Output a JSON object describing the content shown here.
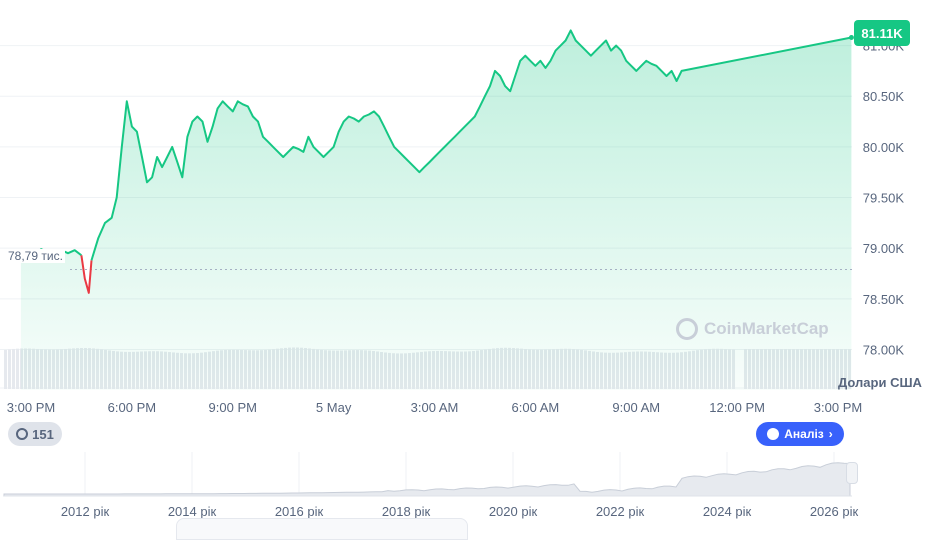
{
  "chart_data": {
    "type": "area",
    "title": "",
    "xlabel": "",
    "ylabel": "",
    "currency_label": "Долари США",
    "current_price_label": "81.11K",
    "reference_label": "78,79 тис.",
    "reference_value": 78790,
    "ylim": [
      77600,
      81450
    ],
    "y_ticks": [
      78000,
      78500,
      79000,
      79500,
      80000,
      80500,
      81000
    ],
    "y_tick_labels": [
      "78.00K",
      "78.50K",
      "79.00K",
      "79.50K",
      "80.00K",
      "80.50K",
      "81.00K"
    ],
    "x_tick_labels": [
      "3:00 PM",
      "6:00 PM",
      "9:00 PM",
      "5 May",
      "3:00 AM",
      "6:00 AM",
      "9:00 AM",
      "12:00 PM",
      "3:00 PM"
    ],
    "x_tick_hours": [
      0,
      3,
      6,
      9,
      12,
      15,
      18,
      21,
      24
    ],
    "series": [
      {
        "points": [
          [
            -0.3,
            78940
          ],
          [
            -0.1,
            78960
          ],
          [
            0.1,
            78930
          ],
          [
            0.3,
            78990
          ],
          [
            0.5,
            78960
          ],
          [
            0.7,
            78940
          ],
          [
            0.9,
            78980
          ],
          [
            1.1,
            78950
          ],
          [
            1.3,
            78980
          ],
          [
            1.5,
            78930
          ],
          [
            1.6,
            78700
          ],
          [
            1.72,
            78560
          ],
          [
            1.8,
            78880
          ],
          [
            2.0,
            79100
          ],
          [
            2.2,
            79250
          ],
          [
            2.4,
            79300
          ],
          [
            2.55,
            79500
          ],
          [
            2.7,
            80000
          ],
          [
            2.85,
            80450
          ],
          [
            3.0,
            80200
          ],
          [
            3.15,
            80150
          ],
          [
            3.3,
            79900
          ],
          [
            3.45,
            79650
          ],
          [
            3.6,
            79700
          ],
          [
            3.75,
            79900
          ],
          [
            3.9,
            79800
          ],
          [
            4.05,
            79900
          ],
          [
            4.2,
            80000
          ],
          [
            4.35,
            79850
          ],
          [
            4.5,
            79700
          ],
          [
            4.65,
            80100
          ],
          [
            4.8,
            80250
          ],
          [
            4.95,
            80300
          ],
          [
            5.1,
            80250
          ],
          [
            5.25,
            80050
          ],
          [
            5.4,
            80200
          ],
          [
            5.55,
            80380
          ],
          [
            5.7,
            80450
          ],
          [
            5.85,
            80400
          ],
          [
            6.0,
            80350
          ],
          [
            6.15,
            80450
          ],
          [
            6.3,
            80420
          ],
          [
            6.45,
            80400
          ],
          [
            6.6,
            80300
          ],
          [
            6.75,
            80250
          ],
          [
            6.9,
            80100
          ],
          [
            7.05,
            80050
          ],
          [
            7.2,
            80000
          ],
          [
            7.35,
            79950
          ],
          [
            7.5,
            79900
          ],
          [
            7.65,
            79950
          ],
          [
            7.8,
            80000
          ],
          [
            7.95,
            79980
          ],
          [
            8.1,
            79950
          ],
          [
            8.25,
            80100
          ],
          [
            8.4,
            80000
          ],
          [
            8.55,
            79950
          ],
          [
            8.7,
            79900
          ],
          [
            8.85,
            79950
          ],
          [
            9.0,
            80000
          ],
          [
            9.15,
            80150
          ],
          [
            9.3,
            80250
          ],
          [
            9.45,
            80300
          ],
          [
            9.6,
            80280
          ],
          [
            9.75,
            80250
          ],
          [
            9.9,
            80300
          ],
          [
            10.05,
            80320
          ],
          [
            10.2,
            80350
          ],
          [
            10.35,
            80300
          ],
          [
            10.5,
            80200
          ],
          [
            10.65,
            80100
          ],
          [
            10.8,
            80000
          ],
          [
            10.95,
            79950
          ],
          [
            11.1,
            79900
          ],
          [
            11.25,
            79850
          ],
          [
            11.4,
            79800
          ],
          [
            11.55,
            79750
          ],
          [
            11.7,
            79800
          ],
          [
            11.85,
            79850
          ],
          [
            12.0,
            79900
          ],
          [
            12.15,
            79950
          ],
          [
            12.3,
            80000
          ],
          [
            12.45,
            80050
          ],
          [
            12.6,
            80100
          ],
          [
            12.75,
            80150
          ],
          [
            12.9,
            80200
          ],
          [
            13.05,
            80250
          ],
          [
            13.2,
            80300
          ],
          [
            13.35,
            80400
          ],
          [
            13.5,
            80500
          ],
          [
            13.65,
            80600
          ],
          [
            13.8,
            80750
          ],
          [
            13.95,
            80700
          ],
          [
            14.1,
            80600
          ],
          [
            14.25,
            80550
          ],
          [
            14.4,
            80700
          ],
          [
            14.55,
            80850
          ],
          [
            14.7,
            80900
          ],
          [
            14.85,
            80850
          ],
          [
            15.0,
            80800
          ],
          [
            15.15,
            80850
          ],
          [
            15.3,
            80780
          ],
          [
            15.45,
            80850
          ],
          [
            15.6,
            80950
          ],
          [
            15.75,
            81000
          ],
          [
            15.9,
            81050
          ],
          [
            16.05,
            81150
          ],
          [
            16.2,
            81050
          ],
          [
            16.35,
            81000
          ],
          [
            16.5,
            80950
          ],
          [
            16.65,
            80900
          ],
          [
            16.8,
            80950
          ],
          [
            16.95,
            81000
          ],
          [
            17.1,
            81050
          ],
          [
            17.25,
            80950
          ],
          [
            17.4,
            81000
          ],
          [
            17.55,
            80950
          ],
          [
            17.7,
            80850
          ],
          [
            17.85,
            80800
          ],
          [
            18.0,
            80750
          ],
          [
            18.15,
            80800
          ],
          [
            18.3,
            80850
          ],
          [
            18.45,
            80820
          ],
          [
            18.6,
            80800
          ],
          [
            18.75,
            80750
          ],
          [
            18.9,
            80700
          ],
          [
            19.05,
            80750
          ],
          [
            19.2,
            80650
          ],
          [
            19.35,
            80750
          ]
        ],
        "last_point": [
          24.4,
          81080
        ]
      }
    ],
    "volume": {
      "label": "volume",
      "level_fraction": 0.7
    },
    "navigator": {
      "year_labels": [
        "2012 рік",
        "2014 рік",
        "2016 рік",
        "2018 рік",
        "2020 рік",
        "2022 рік",
        "2024 рік",
        "2026 рік"
      ]
    }
  },
  "controls": {
    "history_count": "151",
    "analysis_label": "Аналіз",
    "analysis_chevron": "›",
    "watermark": "CoinMarketCap"
  },
  "colors": {
    "up": "#16c784",
    "down": "#ea3943",
    "accent": "#3861fb",
    "text": "#58667e"
  }
}
